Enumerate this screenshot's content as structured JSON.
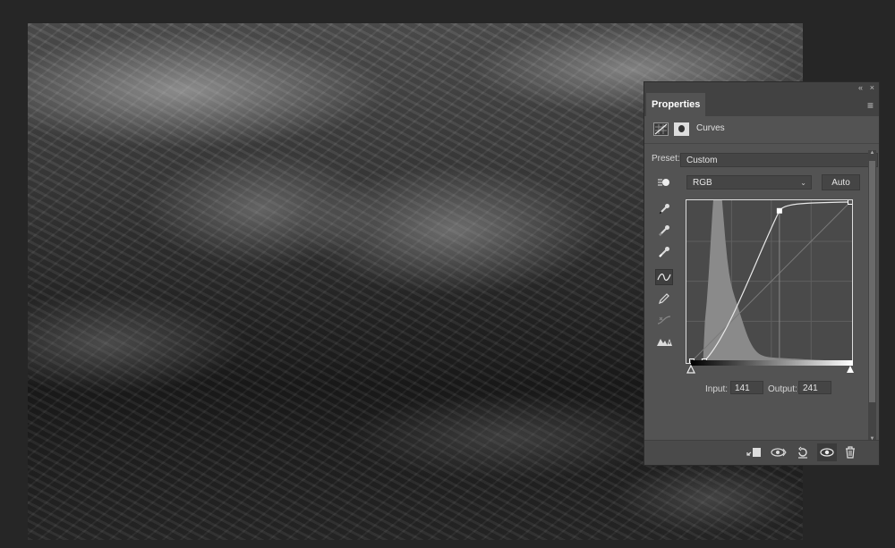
{
  "panel": {
    "tab_label": "Properties",
    "adjustment_title": "Curves",
    "preset_label": "Preset:",
    "preset_value": "Custom",
    "channel_value": "RGB",
    "auto_label": "Auto",
    "input_label": "Input:",
    "input_value": "141",
    "output_label": "Output:",
    "output_value": "241"
  },
  "icons": {
    "collapse": "«",
    "close": "×",
    "menu": "≡",
    "chevron": "⌄"
  },
  "curve": {
    "points": [
      [
        20,
        0
      ],
      [
        141,
        241
      ],
      [
        255,
        255
      ]
    ],
    "colors": {
      "curve": "#e8e8e8",
      "histogram": "#8a8a8a",
      "grid": "#5f5f5f",
      "panel_bg": "#535353"
    }
  }
}
